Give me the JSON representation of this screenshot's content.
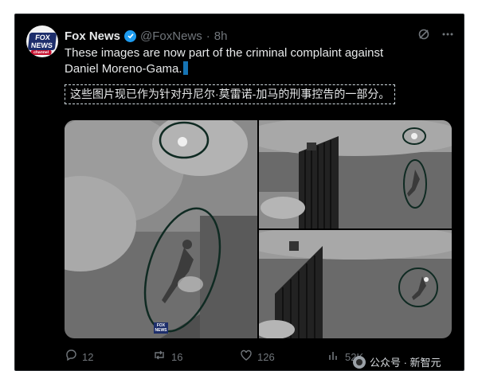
{
  "post": {
    "author_name": "Fox News",
    "handle": "@FoxNews",
    "separator": "·",
    "time": "8h",
    "text": "These images are now part of the criminal complaint against Daniel Moreno-Gama.",
    "translation": "这些图片现已作为针对丹尼尔·莫雷诺-加马的刑事控告的一部分。"
  },
  "avatar": {
    "logo_text": "FOX NEWS",
    "logo_subtext": "channel"
  },
  "icons": {
    "verified": "verified-badge-icon",
    "grok": "grok-icon",
    "more": "more-options-icon",
    "reply": "reply-icon",
    "repost": "repost-icon",
    "like": "like-icon",
    "views": "views-icon"
  },
  "media_bug": "FOX NEWS",
  "actions": {
    "replies": "12",
    "reposts": "16",
    "likes": "126",
    "views": "52K"
  },
  "watermark": {
    "text": "公众号 · 新智元"
  },
  "colors": {
    "background": "#000000",
    "text_primary": "#e7e9ea",
    "text_secondary": "#71767b",
    "verified": "#1d9bf0",
    "highlight_ring": "#0f2a22"
  }
}
